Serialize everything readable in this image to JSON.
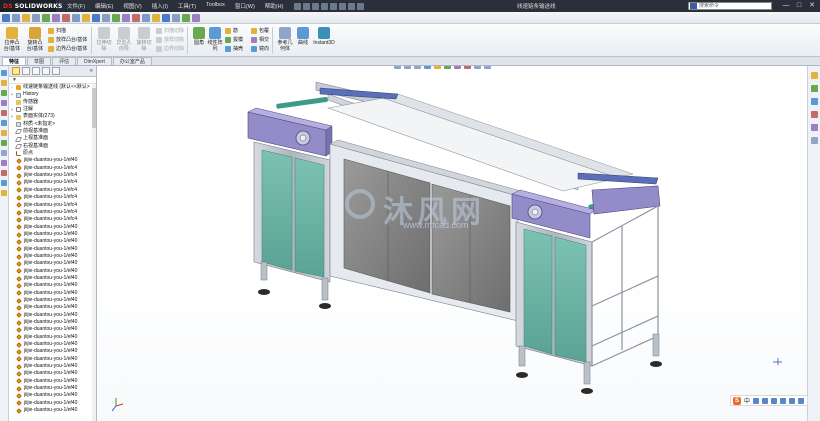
{
  "titlebar": {
    "logo": "SOLIDWORKS",
    "logo_prefix": "DS",
    "menu": [
      "文件(F)",
      "编辑(E)",
      "视图(V)",
      "插入(I)",
      "工具(T)",
      "Toolbox",
      "窗口(W)",
      "帮助(H)"
    ],
    "doc_title": "线速链条输送线",
    "search_placeholder": "搜索命令",
    "win_minimize": "—",
    "win_restore": "□",
    "win_close": "✕"
  },
  "command_manager": {
    "big_tools": [
      {
        "label": "拉伸凸\n台/基体",
        "icon": "extrude-boss-icon"
      },
      {
        "label": "旋转凸\n台/基体",
        "icon": "revolve-boss-icon"
      },
      {
        "label": "拉伸切\n除",
        "icon": "extrude-cut-icon"
      },
      {
        "label": "异型孔\n向导",
        "icon": "hole-wizard-icon"
      },
      {
        "label": "旋转切\n除",
        "icon": "revolve-cut-icon"
      },
      {
        "label": "圆角",
        "icon": "fillet-icon"
      },
      {
        "label": "线性阵\n列",
        "icon": "linear-pattern-icon"
      },
      {
        "label": "参考几\n何体",
        "icon": "reference-geometry-icon"
      },
      {
        "label": "曲线",
        "icon": "curves-icon"
      },
      {
        "label": "Instant3D",
        "icon": "instant3d-icon"
      }
    ],
    "small_tools": [
      {
        "label": "扫描",
        "dim": false
      },
      {
        "label": "放样凸台/基体",
        "dim": false
      },
      {
        "label": "边界凸台/基体",
        "dim": false
      },
      {
        "label": "扫描切除",
        "dim": true
      },
      {
        "label": "放样切除",
        "dim": true
      },
      {
        "label": "边界切除",
        "dim": true
      },
      {
        "label": "筋",
        "dim": false
      },
      {
        "label": "拔模",
        "dim": false
      },
      {
        "label": "抽壳",
        "dim": false
      },
      {
        "label": "包覆",
        "dim": false
      },
      {
        "label": "相交",
        "dim": false
      },
      {
        "label": "镜向",
        "dim": false
      }
    ]
  },
  "tabs": [
    "特征",
    "草图",
    "评估",
    "DimXpert",
    "办公室产品"
  ],
  "feature_tree": {
    "filter": "▼",
    "chevron": "»",
    "root": "线速链条输送线 (默认<<默认>",
    "items": [
      {
        "label": "History",
        "icon": "hist",
        "exp": "+"
      },
      {
        "label": "传感器",
        "icon": "folder",
        "exp": ""
      },
      {
        "label": "注解",
        "icon": "note",
        "exp": "+"
      },
      {
        "label": "表面实体(273)",
        "icon": "folder",
        "exp": "+"
      },
      {
        "label": "材质 <未指定>",
        "icon": "hist",
        "exp": ""
      },
      {
        "label": "前视基准面",
        "icon": "plane",
        "exp": ""
      },
      {
        "label": "上视基准面",
        "icon": "plane",
        "exp": ""
      },
      {
        "label": "右视基准面",
        "icon": "plane",
        "exp": ""
      },
      {
        "label": "原点",
        "icon": "origin",
        "exp": ""
      },
      {
        "label": "jiijie-duantou-you-1/ef40",
        "icon": "part",
        "exp": ""
      },
      {
        "label": "jiijie-duantou-you-1/efc4",
        "icon": "part",
        "exp": ""
      },
      {
        "label": "jiijie-duantou-you-1/efc4",
        "icon": "part",
        "exp": ""
      },
      {
        "label": "jiijie-duantou-you-1/efc4",
        "icon": "part",
        "exp": ""
      },
      {
        "label": "jiijie-duantou-you-1/efc4",
        "icon": "part",
        "exp": ""
      },
      {
        "label": "jiijie-duantou-you-1/efc4",
        "icon": "part",
        "exp": ""
      },
      {
        "label": "jiijie-duantou-you-1/efc4",
        "icon": "part",
        "exp": ""
      },
      {
        "label": "jiijie-duantou-you-1/efc4",
        "icon": "part",
        "exp": ""
      },
      {
        "label": "jiijie-duantou-you-1/efc4",
        "icon": "part",
        "exp": ""
      },
      {
        "label": "jiijie-duantou-you-1/ef40",
        "icon": "part",
        "exp": ""
      },
      {
        "label": "jiijie-duantou-you-1/ef40",
        "icon": "part",
        "exp": ""
      },
      {
        "label": "jiijie-duantou-you-1/ef40",
        "icon": "part",
        "exp": ""
      },
      {
        "label": "jiijie-duantou-you-1/ef40",
        "icon": "part",
        "exp": ""
      },
      {
        "label": "jiijie-duantou-you-1/ef40",
        "icon": "part",
        "exp": ""
      },
      {
        "label": "jiijie-duantou-you-1/ef40",
        "icon": "part",
        "exp": ""
      },
      {
        "label": "jiijie-duantou-you-1/ef40",
        "icon": "part",
        "exp": ""
      },
      {
        "label": "jiijie-duantou-you-1/ef40",
        "icon": "part",
        "exp": ""
      },
      {
        "label": "jiijie-duantou-you-1/ef40",
        "icon": "part",
        "exp": ""
      },
      {
        "label": "jiijie-duantou-you-1/ef40",
        "icon": "part",
        "exp": ""
      },
      {
        "label": "jiijie-duantou-you-1/ef40",
        "icon": "part",
        "exp": ""
      },
      {
        "label": "jiijie-duantou-you-1/ef40",
        "icon": "part",
        "exp": ""
      },
      {
        "label": "jiijie-duantou-you-1/ef40",
        "icon": "part",
        "exp": ""
      },
      {
        "label": "jiijie-duantou-you-1/ef40",
        "icon": "part",
        "exp": ""
      },
      {
        "label": "jiijie-duantou-you-1/ef40",
        "icon": "part",
        "exp": ""
      },
      {
        "label": "jiijie-duantou-you-1/ef40",
        "icon": "part",
        "exp": ""
      },
      {
        "label": "jiijie-duantou-you-1/ef40",
        "icon": "part",
        "exp": ""
      },
      {
        "label": "jiijie-duantou-you-1/ef40",
        "icon": "part",
        "exp": ""
      },
      {
        "label": "jiijie-duantou-you-1/ef40",
        "icon": "part",
        "exp": ""
      },
      {
        "label": "jiijie-duantou-you-1/ef40",
        "icon": "part",
        "exp": ""
      },
      {
        "label": "jiijie-duantou-you-1/ef40",
        "icon": "part",
        "exp": ""
      },
      {
        "label": "jiijie-duantou-you-1/ef40",
        "icon": "part",
        "exp": ""
      },
      {
        "label": "jiijie-duantou-you-1/ef40",
        "icon": "part",
        "exp": ""
      },
      {
        "label": "jiijie-duantou-you-1/ef40",
        "icon": "part",
        "exp": ""
      },
      {
        "label": "jiijie-duantou-you-1/ef40",
        "icon": "part",
        "exp": ""
      },
      {
        "label": "jiijie-duantou-you-1/ef40",
        "icon": "part",
        "exp": ""
      }
    ]
  },
  "watermark": {
    "text": "沐风网",
    "url": "www.mfcad.com"
  },
  "ime_bar": {
    "logo": "S",
    "mode": "中"
  },
  "colors": {
    "panel_teal": "#6fb7a8",
    "panel_purple": "#8f86c4",
    "frame_gray": "#b9c0c8",
    "glass": "#8a8a8a",
    "titlebar": "#2b2f3a"
  }
}
